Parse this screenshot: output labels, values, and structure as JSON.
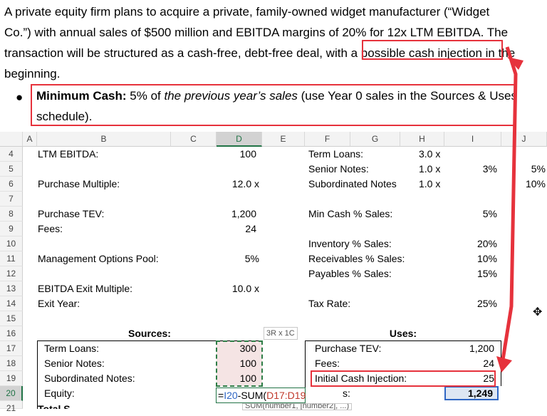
{
  "paragraph": {
    "line1": "A private equity firm plans to acquire a private, family-owned widget manufacturer (“Widget",
    "line2": "Co.”) with annual sales of $500 million and EBITDA margins of 20% for 12x LTM EBITDA. The",
    "line3a": "transaction will be structured as a cash-free, debt-free deal, with ",
    "line3b": "a possible cash injection",
    "line3c": " in the",
    "line4": "beginning."
  },
  "bullet": {
    "bold": "Minimum Cash:",
    "t1": " 5% of ",
    "italic": "the previous year’s sales",
    "t2": " (use Year 0 sales in the Sources & Uses",
    "line2": "schedule)."
  },
  "columns": [
    "A",
    "B",
    "C",
    "D",
    "E",
    "F",
    "G",
    "H",
    "I",
    "J"
  ],
  "rows": [
    "4",
    "5",
    "6",
    "7",
    "8",
    "9",
    "10",
    "11",
    "12",
    "13",
    "14",
    "15",
    "16",
    "17",
    "18",
    "19",
    "20",
    "21"
  ],
  "cells": {
    "b4": "LTM EBITDA:",
    "d4": "100",
    "f4": "Term Loans:",
    "h4": "3.0 x",
    "f5": "Senior Notes:",
    "h5": "1.0 x",
    "i5": "3%",
    "j5": "5%",
    "b6": "Purchase Multiple:",
    "d6": "12.0 x",
    "f6": "Subordinated Notes",
    "h6": "1.0 x",
    "j6": "10%",
    "b8": "Purchase TEV:",
    "d8": "1,200",
    "f8": "Min Cash % Sales:",
    "i8": "5%",
    "b9": "Fees:",
    "d9": "24",
    "f10": "Inventory % Sales:",
    "i10": "20%",
    "b11": "Management Options Pool:",
    "d11": "5%",
    "f11": "Receivables % Sales:",
    "i11": "10%",
    "f12": "Payables % Sales:",
    "i12": "15%",
    "b13": "EBITDA Exit Multiple:",
    "d13": "10.0 x",
    "b14": "Exit Year:",
    "f14": "Tax Rate:",
    "i14": "25%",
    "sources": "Sources:",
    "uses": "Uses:",
    "b17": "Term Loans:",
    "d17": "300",
    "f17": "Purchase TEV:",
    "i17": "1,200",
    "b18": "Senior Notes:",
    "d18": "100",
    "f18": "Fees:",
    "i18": "24",
    "b19": "Subordinated Notes:",
    "d19": "100",
    "f19": "Initial Cash Injection:",
    "i19": "25",
    "b20": "Equity:",
    "f20": "s:",
    "i20": "1,249",
    "b21": "Total S"
  },
  "formula": {
    "eq": "=",
    "ref1": "I20",
    "mid": "-SUM(",
    "ref2": "D17:D19"
  },
  "tooltip_size": "3R x 1C",
  "func_hint": "SUM(number1, [number2], ...)",
  "cursor_icon": "move-cursor-icon"
}
